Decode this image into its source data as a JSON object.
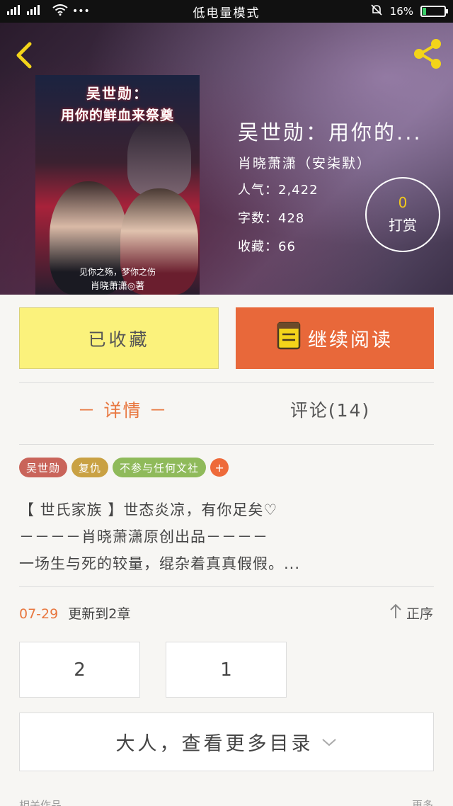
{
  "status_bar": {
    "signal_left": "2G 4G",
    "mode": "低电量模式",
    "battery_percent": "16%",
    "battery_level": 0.16
  },
  "book": {
    "cover": {
      "title_line1": "吴世勋：",
      "title_line2": "用你的鲜血来祭奠",
      "tagline": "见你之殇，梦你之伤",
      "author": "肖晓萧潇◎著"
    },
    "title": "吴世勋：用你的...",
    "author": "肖晓萧潇（安柒默）",
    "popularity": "人气：2,422",
    "word_count": "字数：428",
    "favorites": "收藏：66",
    "tip_count": "0",
    "tip_label": "打赏"
  },
  "actions": {
    "collected_label": "已收藏",
    "read_label": "继续阅读"
  },
  "tabs": {
    "detail": "－ 详情 －",
    "comments": "评论(14)"
  },
  "tags": [
    {
      "label": "吴世勋",
      "color": "#c9645a"
    },
    {
      "label": "复仇",
      "color": "#c9a143"
    },
    {
      "label": "不参与任何文社",
      "color": "#8fba5a"
    }
  ],
  "description": {
    "line1": "【 世氏家族 】世态炎凉，有你足矣♡",
    "line2": "－－－－肖晓萧潇原创出品－－－－",
    "line3": "一场生与死的较量，绲杂着真真假假。..."
  },
  "update": {
    "date": "07-29",
    "text": "更新到2章",
    "sort_label": "正序"
  },
  "chapters": [
    "2",
    "1"
  ],
  "more_label": "大人，查看更多目录",
  "bottom": {
    "left": "相关作品",
    "right": "更多"
  },
  "colors": {
    "accent": "#e8773f",
    "read_button": "#e8683a",
    "collected_button": "#fbf27c",
    "tip_count": "#f3cb1a"
  }
}
